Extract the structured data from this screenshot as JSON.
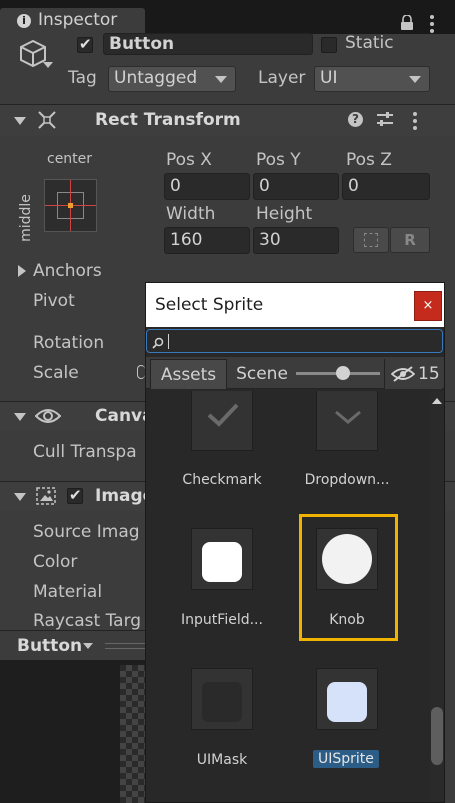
{
  "tab": {
    "icon": "info-icon",
    "title": "Inspector"
  },
  "gameobject": {
    "name": "Button",
    "static_label": "Static",
    "tag_label": "Tag",
    "tag_value": "Untagged",
    "layer_label": "Layer",
    "layer_value": "UI"
  },
  "rect_transform": {
    "title": "Rect Transform",
    "anchor_top_label": "center",
    "anchor_side_label": "middle",
    "pos_x_label": "Pos X",
    "pos_y_label": "Pos Y",
    "pos_z_label": "Pos Z",
    "pos_x": "0",
    "pos_y": "0",
    "pos_z": "0",
    "width_label": "Width",
    "height_label": "Height",
    "width": "160",
    "height": "30",
    "raw_button": "R",
    "anchors_label": "Anchors",
    "pivot_label": "Pivot",
    "rotation_label": "Rotation",
    "scale_label": "Scale"
  },
  "canvas_renderer": {
    "title": "Canva",
    "cull_label": "Cull Transpa"
  },
  "image": {
    "title": "Image",
    "source_label": "Source Imag",
    "color_label": "Color",
    "material_label": "Material",
    "raycast_label": "Raycast Targ"
  },
  "preview": {
    "label": "Button"
  },
  "popup": {
    "title": "Select Sprite",
    "close_label": "×",
    "search_value": "",
    "tabs": {
      "assets": "Assets",
      "scene": "Scene"
    },
    "hidden_count": "15",
    "items": [
      {
        "label": "Checkmark"
      },
      {
        "label": "Dropdown..."
      },
      {
        "label": "InputField..."
      },
      {
        "label": "Knob"
      },
      {
        "label": "UIMask"
      },
      {
        "label": "UISprite"
      }
    ],
    "selected": "Knob",
    "highlight_color": "#f0b400",
    "label_highlight_color": "#2c5d87"
  }
}
